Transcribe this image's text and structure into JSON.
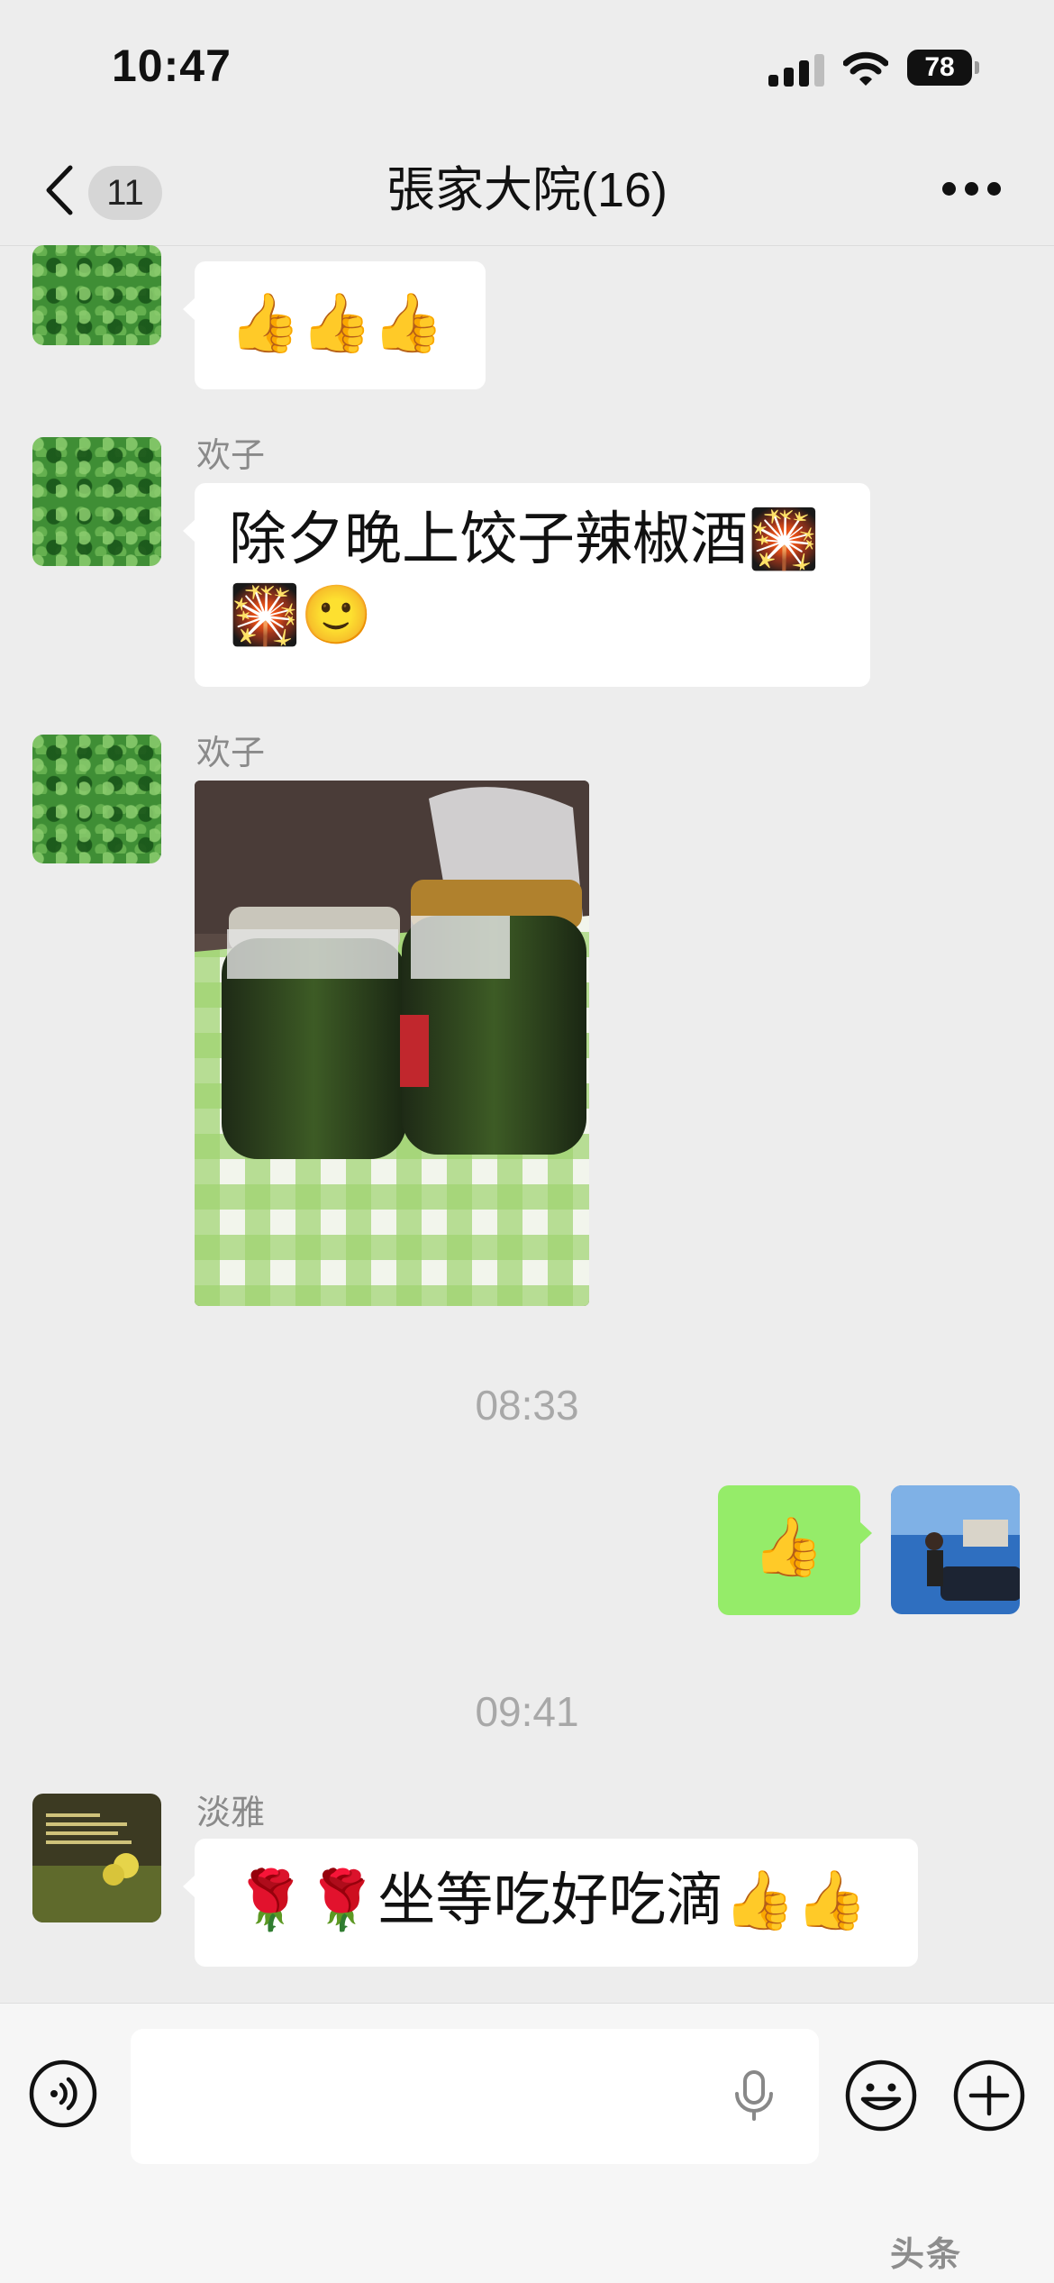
{
  "status_bar": {
    "time": "10:47",
    "battery": "78"
  },
  "nav": {
    "back_count": "11",
    "title": "張家大院(16)"
  },
  "messages": {
    "m1_text": "👍👍👍",
    "m2_sender": "欢子",
    "m2_text": "除夕晚上饺子辣椒酒🎇\n🎇🙂",
    "m3_sender": "欢子",
    "time1": "08:33",
    "m4_text": "👍",
    "time2": "09:41",
    "m5_sender": "淡雅",
    "m5_text": "🌹🌹坐等吃好吃滴👍👍"
  },
  "input": {
    "placeholder": ""
  },
  "watermark": "头条"
}
